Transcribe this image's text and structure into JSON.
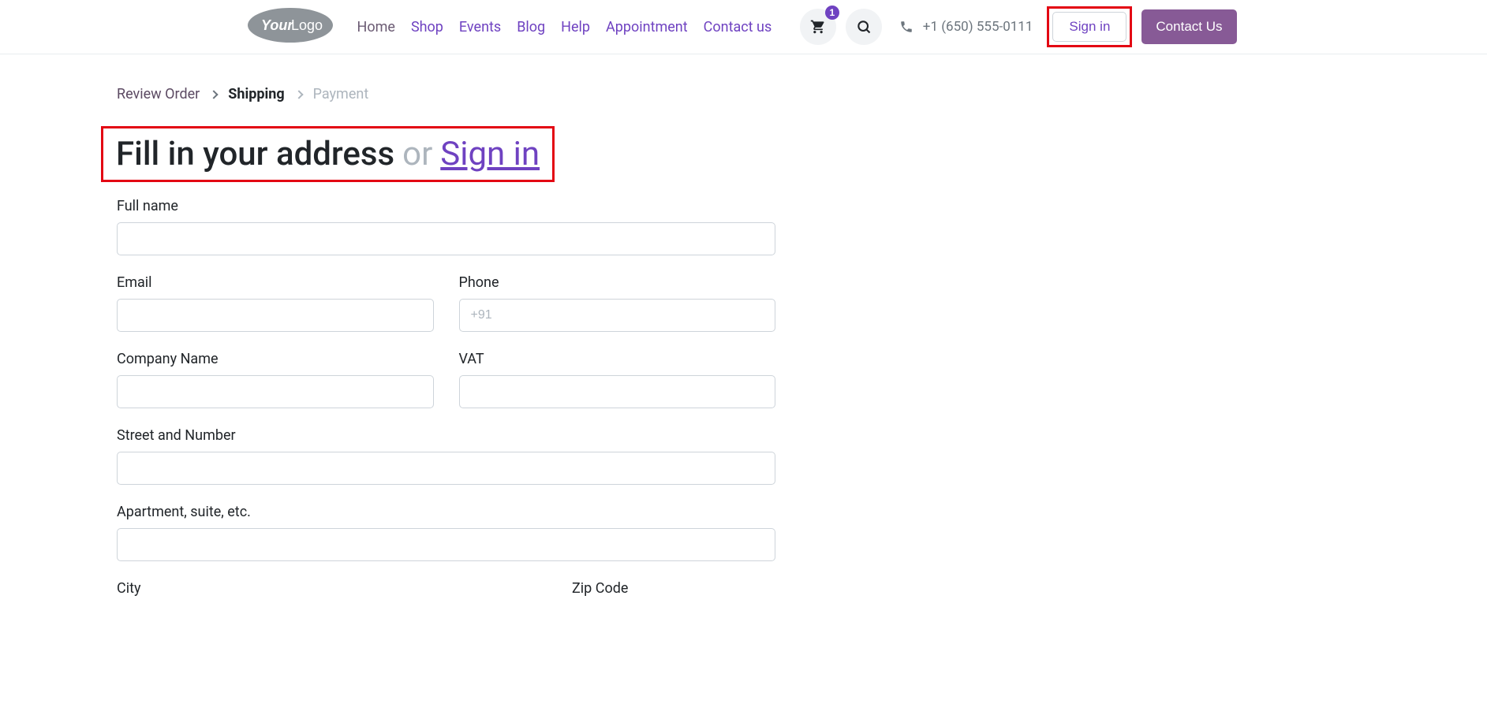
{
  "header": {
    "logo_text_1": "Your",
    "logo_text_2": "Logo",
    "nav": {
      "home": "Home",
      "shop": "Shop",
      "events": "Events",
      "blog": "Blog",
      "help": "Help",
      "appointment": "Appointment",
      "contact": "Contact us"
    },
    "cart_badge": "1",
    "phone": "+1 (650) 555-0111",
    "signin": "Sign in",
    "contact_us": "Contact Us"
  },
  "breadcrumb": {
    "review": "Review Order",
    "shipping": "Shipping",
    "payment": "Payment"
  },
  "heading": {
    "text": "Fill in your address",
    "or": "or",
    "signin": "Sign in"
  },
  "form": {
    "full_name": "Full name",
    "email": "Email",
    "phone": "Phone",
    "phone_placeholder": "+91",
    "company": "Company Name",
    "vat": "VAT",
    "street": "Street and Number",
    "apartment": "Apartment, suite, etc.",
    "city": "City",
    "zip": "Zip Code"
  }
}
